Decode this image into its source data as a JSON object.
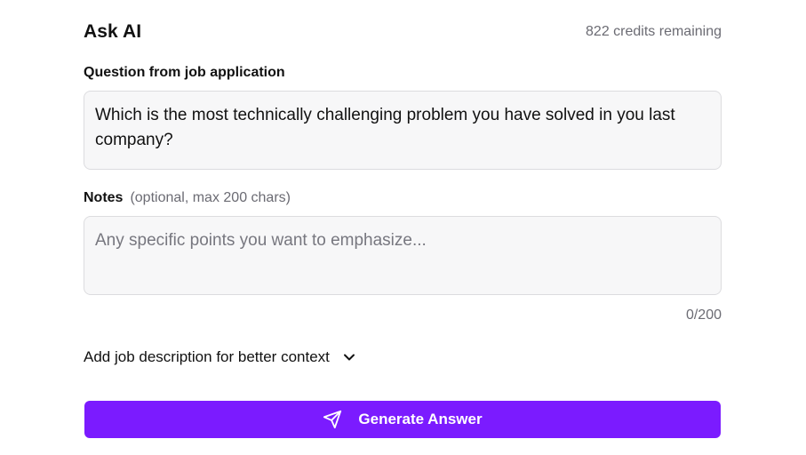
{
  "header": {
    "title": "Ask AI",
    "credits": "822 credits remaining"
  },
  "question": {
    "label": "Question from job application",
    "value": "Which is the most technically challenging problem you have solved in you last company?"
  },
  "notes": {
    "label": "Notes",
    "hint": "(optional, max 200 chars)",
    "placeholder": "Any specific points you want to emphasize...",
    "value": "",
    "counter": "0/200"
  },
  "job_description_toggle": {
    "label": "Add job description for better context",
    "icon": "chevron-down-icon"
  },
  "generate_button": {
    "label": "Generate Answer",
    "icon": "send-icon",
    "color": "#7b1bff"
  }
}
